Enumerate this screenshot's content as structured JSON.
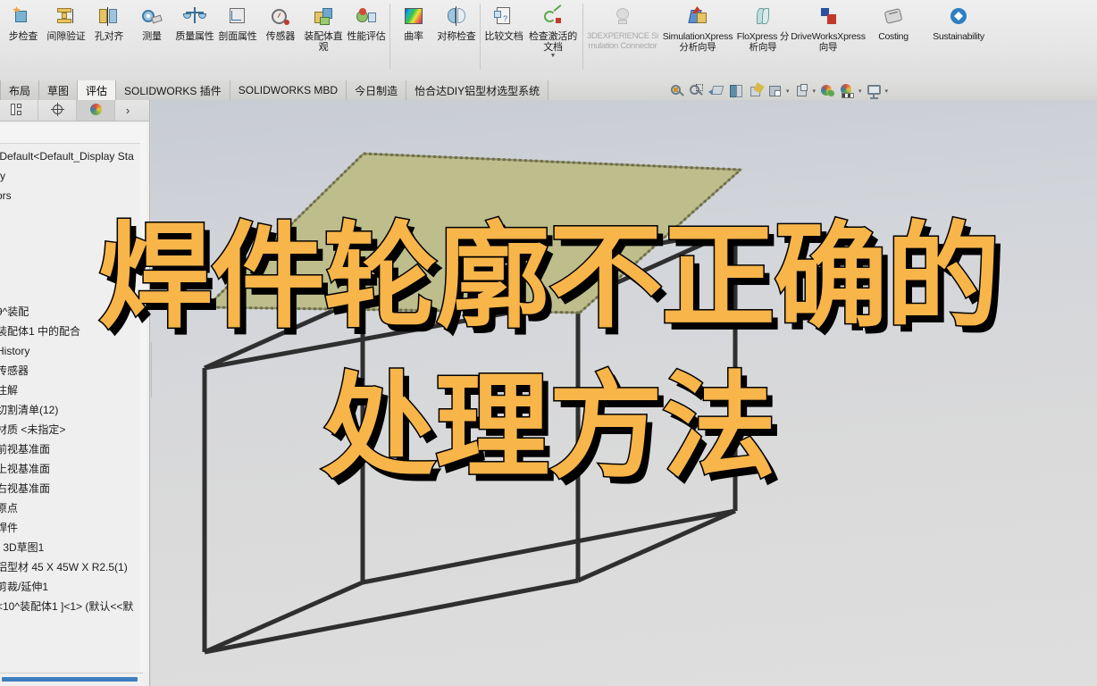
{
  "app": {
    "name": "SOLIDWORKS",
    "accent_orange": "#f7b54a",
    "viewport_bg_top": "#c8ccd3",
    "viewport_bg_bottom": "#dedede",
    "model_face_color": "#bdbe8c"
  },
  "ribbon": {
    "groups": [
      {
        "name": "evaluate-tools",
        "buttons": [
          {
            "label": "步检查",
            "icon": "interference-check-icon",
            "disabled": false
          },
          {
            "label": "间隙验证",
            "icon": "clearance-verification-icon",
            "disabled": false
          },
          {
            "label": "孔对齐",
            "icon": "hole-alignment-icon",
            "disabled": false
          },
          {
            "label": "测量",
            "icon": "measure-icon",
            "disabled": false
          },
          {
            "label": "质量属性",
            "icon": "mass-properties-icon",
            "disabled": false
          },
          {
            "label": "剖面属性",
            "icon": "section-properties-icon",
            "disabled": false
          },
          {
            "label": "传感器",
            "icon": "sensor-icon",
            "disabled": false
          },
          {
            "label": "装配体直观",
            "icon": "assembly-visualization-icon",
            "disabled": false
          },
          {
            "label": "性能评估",
            "icon": "performance-evaluation-icon",
            "disabled": false
          }
        ]
      },
      {
        "name": "geometry-analysis",
        "buttons": [
          {
            "label": "曲率",
            "icon": "curvature-icon",
            "disabled": false
          },
          {
            "label": "对称检查",
            "icon": "symmetry-check-icon",
            "disabled": false
          }
        ]
      },
      {
        "name": "document-tools",
        "buttons": [
          {
            "label": "比较文档",
            "icon": "compare-documents-icon",
            "disabled": false
          },
          {
            "label": "检查激活的文档",
            "icon": "check-active-document-icon",
            "disabled": false,
            "has_caret": true
          }
        ]
      },
      {
        "name": "xpress-tools",
        "buttons": [
          {
            "label": "3DEXPERIENCE Simulation Connector",
            "icon": "3dexperience-simulation-connector-icon",
            "disabled": true
          },
          {
            "label": "SimulationXpress 分析向导",
            "icon": "simulationxpress-icon",
            "disabled": false
          },
          {
            "label": "FloXpress 分析向导",
            "icon": "floxpress-icon",
            "disabled": false
          },
          {
            "label": "DriveWorksXpress 向导",
            "icon": "driveworksxpress-icon",
            "disabled": false
          },
          {
            "label": "Costing",
            "icon": "costing-icon",
            "disabled": false
          },
          {
            "label": "Sustainability",
            "icon": "sustainability-icon",
            "disabled": false
          }
        ]
      }
    ]
  },
  "tabs": {
    "items": [
      {
        "label": "布局",
        "active": false
      },
      {
        "label": "草图",
        "active": false
      },
      {
        "label": "评估",
        "active": true
      },
      {
        "label": "SOLIDWORKS 插件",
        "active": false
      },
      {
        "label": "SOLIDWORKS MBD",
        "active": false
      },
      {
        "label": "今日制造",
        "active": false
      },
      {
        "label": "怡合达DIY铝型材选型系统",
        "active": false
      }
    ]
  },
  "view_toolbar": {
    "items": [
      {
        "name": "zoom-to-fit-icon",
        "has_caret": false
      },
      {
        "name": "zoom-to-area-icon",
        "has_caret": false
      },
      {
        "name": "previous-view-icon",
        "has_caret": false
      },
      {
        "name": "section-view-icon",
        "has_caret": false
      },
      {
        "name": "view-orientation-icon",
        "has_caret": false
      },
      {
        "name": "display-style-icon",
        "has_caret": true
      },
      {
        "name": "hide-show-items-icon",
        "has_caret": true
      },
      {
        "name": "edit-appearance-icon",
        "has_caret": false
      },
      {
        "name": "apply-scene-icon",
        "has_caret": true
      },
      {
        "name": "view-settings-icon",
        "has_caret": true
      }
    ]
  },
  "sidebar": {
    "panel_tabs": [
      {
        "name": "feature-manager-tab",
        "selected": false
      },
      {
        "name": "property-manager-tab",
        "selected": false
      },
      {
        "name": "display-manager-tab",
        "selected": true
      },
      {
        "name": "expand-panel-arrow",
        "selected": false
      }
    ],
    "tree_items": [
      "[Default<Default_Display Sta",
      "ry",
      "ors",
      "9^装配",
      "装配体1 中的配合",
      "History",
      "传感器",
      "注解",
      "切割清单(12)",
      "材质 <未指定>",
      "前视基准面",
      "上视基准面",
      "右视基准面",
      "原点",
      "焊件",
      ") 3D草图1",
      "铝型材 45 X 45W X R2.5(1)",
      "剪裁/延伸1",
      "<10^装配体1 ]<1> (默认<<默"
    ]
  },
  "overlay": {
    "line1": "焊件轮廓不正确的",
    "line2": "处理方法"
  }
}
